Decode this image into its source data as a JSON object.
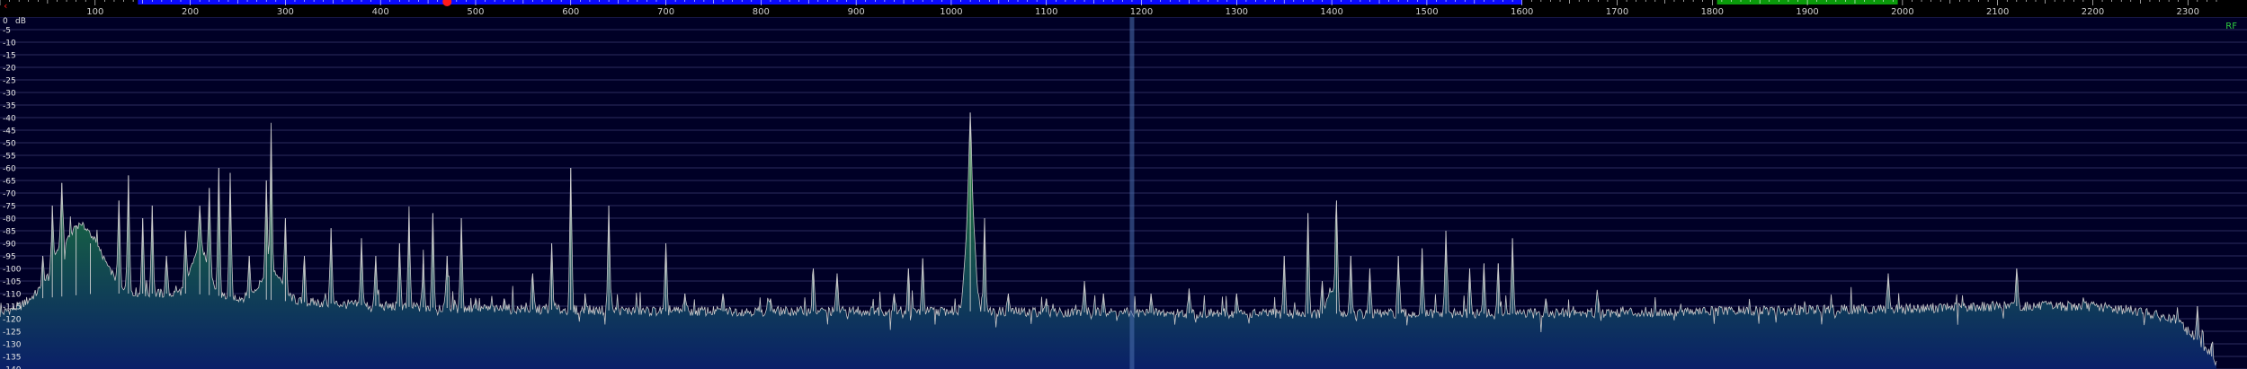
{
  "frequency_scale": {
    "labels": [
      "100",
      "200",
      "300",
      "400",
      "500",
      "600",
      "700",
      "800",
      "900",
      "1000",
      "1100",
      "1200",
      "1300",
      "1400",
      "1500",
      "1600",
      "1700",
      "1800",
      "1900",
      "2000",
      "2100",
      "2200",
      "2300"
    ],
    "ticks": [
      100,
      200,
      300,
      400,
      500,
      600,
      700,
      800,
      900,
      1000,
      1100,
      1200,
      1300,
      1400,
      1500,
      1600,
      1700,
      1800,
      1900,
      2000,
      2100,
      2200,
      2300
    ],
    "range": [
      0,
      2330
    ],
    "band_blue": [
      145,
      1600
    ],
    "band_green": [
      1805,
      1995
    ],
    "marker_freq": 470,
    "colors": {
      "blue_band": "#0a0aff",
      "green_band": "#0a9a0a",
      "marker": "#ff1a1a",
      "text": "#cfcfcf"
    }
  },
  "display": {
    "rf_label": "RF",
    "db_unit": "dB",
    "db_labels": [
      "0",
      "-5",
      "-10",
      "-15",
      "-20",
      "-25",
      "-30",
      "-35",
      "-40",
      "-45",
      "-50",
      "-55",
      "-60",
      "-65",
      "-70",
      "-75",
      "-80",
      "-85",
      "-90",
      "-95",
      "-100",
      "-105",
      "-110",
      "-115",
      "-120",
      "-125",
      "-130",
      "-135",
      "-140"
    ],
    "db_range": [
      0,
      -140
    ],
    "colors": {
      "bg": "#000026",
      "grid": "#3a3a70",
      "trace": "#c8c8c8",
      "fill_top": "#1f8c2a",
      "fill_bottom": "#0a2068",
      "marker_line": "#4a6fb0",
      "rf": "#2ecc40"
    }
  },
  "chart_data": {
    "type": "area",
    "xlabel": "",
    "ylabel": "",
    "xlim": [
      0,
      2330
    ],
    "ylim": [
      -140,
      0
    ],
    "x_unit": "Hz",
    "y_unit": "dB",
    "marker_x": 1190,
    "noise_floor": [
      [
        0,
        -118
      ],
      [
        40,
        -112
      ],
      [
        100,
        -110
      ],
      [
        200,
        -110
      ],
      [
        300,
        -113
      ],
      [
        400,
        -115
      ],
      [
        500,
        -116
      ],
      [
        700,
        -117
      ],
      [
        1000,
        -117
      ],
      [
        1300,
        -118
      ],
      [
        1600,
        -118
      ],
      [
        1800,
        -117
      ],
      [
        2000,
        -116
      ],
      [
        2100,
        -115
      ],
      [
        2200,
        -115
      ],
      [
        2250,
        -117
      ],
      [
        2290,
        -121
      ],
      [
        2320,
        -132
      ],
      [
        2330,
        -138
      ]
    ],
    "humps": [
      {
        "center": 85,
        "width": 30,
        "level": -83
      },
      {
        "center": 70,
        "width": 12,
        "level": -90
      },
      {
        "center": 210,
        "width": 12,
        "level": -92
      },
      {
        "center": 285,
        "width": 15,
        "level": -100
      },
      {
        "center": 1020,
        "width": 6,
        "level": -65
      },
      {
        "center": 1400,
        "width": 6,
        "level": -108
      }
    ],
    "peaks": [
      {
        "x": 45,
        "y": -95
      },
      {
        "x": 55,
        "y": -75
      },
      {
        "x": 65,
        "y": -66
      },
      {
        "x": 80,
        "y": -83
      },
      {
        "x": 95,
        "y": -90
      },
      {
        "x": 125,
        "y": -73
      },
      {
        "x": 135,
        "y": -63
      },
      {
        "x": 150,
        "y": -80
      },
      {
        "x": 160,
        "y": -75
      },
      {
        "x": 175,
        "y": -95
      },
      {
        "x": 195,
        "y": -85
      },
      {
        "x": 210,
        "y": -75
      },
      {
        "x": 220,
        "y": -68
      },
      {
        "x": 230,
        "y": -60
      },
      {
        "x": 242,
        "y": -62
      },
      {
        "x": 262,
        "y": -95
      },
      {
        "x": 285,
        "y": -50
      },
      {
        "x": 280,
        "y": -65
      },
      {
        "x": 300,
        "y": -80
      },
      {
        "x": 320,
        "y": -95
      },
      {
        "x": 348,
        "y": -84
      },
      {
        "x": 380,
        "y": -88
      },
      {
        "x": 395,
        "y": -95
      },
      {
        "x": 420,
        "y": -90
      },
      {
        "x": 430,
        "y": -80
      },
      {
        "x": 445,
        "y": -98
      },
      {
        "x": 455,
        "y": -78
      },
      {
        "x": 470,
        "y": -95
      },
      {
        "x": 485,
        "y": -80
      },
      {
        "x": 500,
        "y": -112
      },
      {
        "x": 530,
        "y": -112
      },
      {
        "x": 560,
        "y": -102
      },
      {
        "x": 580,
        "y": -90
      },
      {
        "x": 600,
        "y": -60
      },
      {
        "x": 615,
        "y": -110
      },
      {
        "x": 640,
        "y": -75
      },
      {
        "x": 700,
        "y": -90
      },
      {
        "x": 720,
        "y": -110
      },
      {
        "x": 760,
        "y": -110
      },
      {
        "x": 810,
        "y": -112
      },
      {
        "x": 855,
        "y": -100
      },
      {
        "x": 880,
        "y": -102
      },
      {
        "x": 940,
        "y": -110
      },
      {
        "x": 955,
        "y": -100
      },
      {
        "x": 970,
        "y": -96
      },
      {
        "x": 1020,
        "y": -38
      },
      {
        "x": 1035,
        "y": -80
      },
      {
        "x": 1060,
        "y": -110
      },
      {
        "x": 1100,
        "y": -112
      },
      {
        "x": 1140,
        "y": -105
      },
      {
        "x": 1160,
        "y": -110
      },
      {
        "x": 1210,
        "y": -110
      },
      {
        "x": 1250,
        "y": -108
      },
      {
        "x": 1300,
        "y": -110
      },
      {
        "x": 1350,
        "y": -95
      },
      {
        "x": 1375,
        "y": -78
      },
      {
        "x": 1390,
        "y": -105
      },
      {
        "x": 1405,
        "y": -73
      },
      {
        "x": 1420,
        "y": -95
      },
      {
        "x": 1440,
        "y": -100
      },
      {
        "x": 1470,
        "y": -95
      },
      {
        "x": 1495,
        "y": -92
      },
      {
        "x": 1520,
        "y": -85
      },
      {
        "x": 1545,
        "y": -100
      },
      {
        "x": 1560,
        "y": -98
      },
      {
        "x": 1575,
        "y": -98
      },
      {
        "x": 1590,
        "y": -88
      },
      {
        "x": 1625,
        "y": -112
      },
      {
        "x": 1680,
        "y": -112
      },
      {
        "x": 1985,
        "y": -102
      },
      {
        "x": 2120,
        "y": -100
      },
      {
        "x": 2310,
        "y": -115
      },
      {
        "x": 2325,
        "y": -130
      }
    ]
  }
}
